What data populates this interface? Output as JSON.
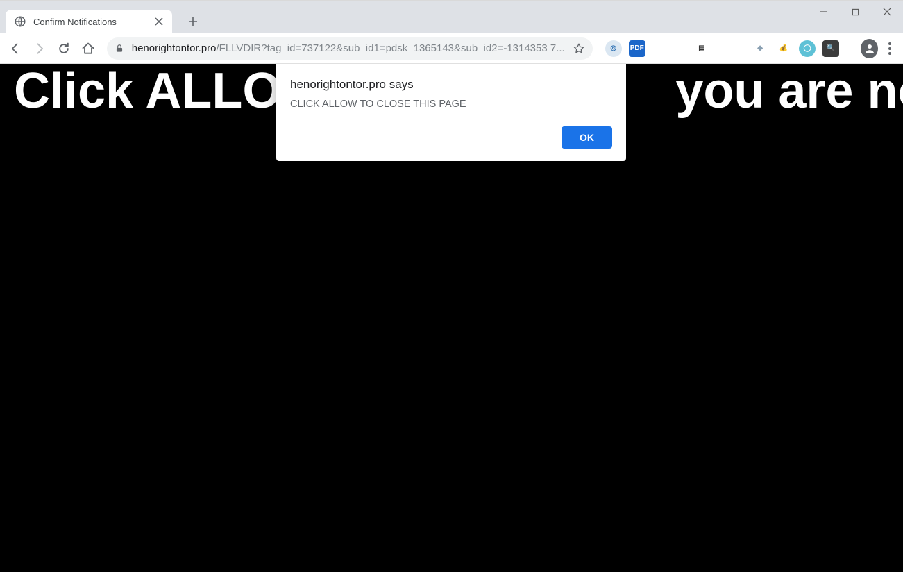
{
  "window_controls": {
    "minimize": "–",
    "maximize": "□",
    "close": "×"
  },
  "tab": {
    "title": "Confirm Notifications"
  },
  "url": {
    "domain": "henorightontor.pro",
    "path": "/FLLVDIR?tag_id=737122&sub_id1=pdsk_1365143&sub_id2=-1314353 7..."
  },
  "extensions": [
    {
      "name": "ext-1-swirl-icon",
      "bg": "#dbe7f2",
      "fg": "#2b6fb3",
      "label": "◎"
    },
    {
      "name": "ext-2-pdf-icon",
      "bg": "#1b66c9",
      "fg": "#ffffff",
      "label": "PDF"
    },
    {
      "name": "ext-3-box-icon",
      "bg": "#ffffff",
      "fg": "#333333",
      "label": "▤"
    },
    {
      "name": "ext-4-stack-icon",
      "bg": "#ffffff",
      "fg": "#8aa0b2",
      "label": "◆"
    },
    {
      "name": "ext-5-bag-icon",
      "bg": "#ffffff",
      "fg": "#b47a2e",
      "label": "💰"
    },
    {
      "name": "ext-6-ring-icon",
      "bg": "#5ec1d6",
      "fg": "#ffffff",
      "label": "◯"
    },
    {
      "name": "ext-7-magnifier-icon",
      "bg": "#3c3c3c",
      "fg": "#ffffff",
      "label": "🔍"
    }
  ],
  "page": {
    "headline_left": "Click ALLOW",
    "headline_right": "you are not a"
  },
  "alert": {
    "origin_text": "henorightontor.pro says",
    "message": "CLICK ALLOW TO CLOSE THIS PAGE",
    "ok_label": "OK"
  }
}
